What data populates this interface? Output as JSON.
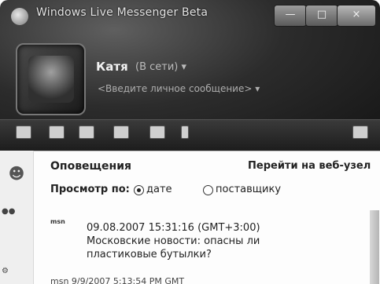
{
  "window": {
    "title": "Windows Live Messenger Beta"
  },
  "window_controls": {
    "minimize": "—",
    "maximize": "□",
    "close": "×"
  },
  "profile": {
    "name": "Катя",
    "status": "(В сети) ▾",
    "personal_message": "<Введите личное сообщение> ▾"
  },
  "toolbar": {
    "icons": [
      "contacts-icon",
      "share-icon",
      "games-icon",
      "calendar-icon",
      "music-icon",
      "phone-icon",
      "settings-icon"
    ]
  },
  "alerts": {
    "title": "Оповещения",
    "website_link": "Перейти на веб-узел",
    "sort_label": "Просмотр по:",
    "sort_options": [
      {
        "label": "дате",
        "checked": true
      },
      {
        "label": "поставщику",
        "checked": false
      }
    ],
    "items": [
      {
        "source": "msn",
        "datetime": "09.08.2007 15:31:16 (GMT+3:00)",
        "text_line1": "Московские новости: опасны ли",
        "text_line2": "пластиковые бутылки?"
      }
    ],
    "next_item_partial": "msn 9/9/2007 5:13:54 PM GMT"
  }
}
